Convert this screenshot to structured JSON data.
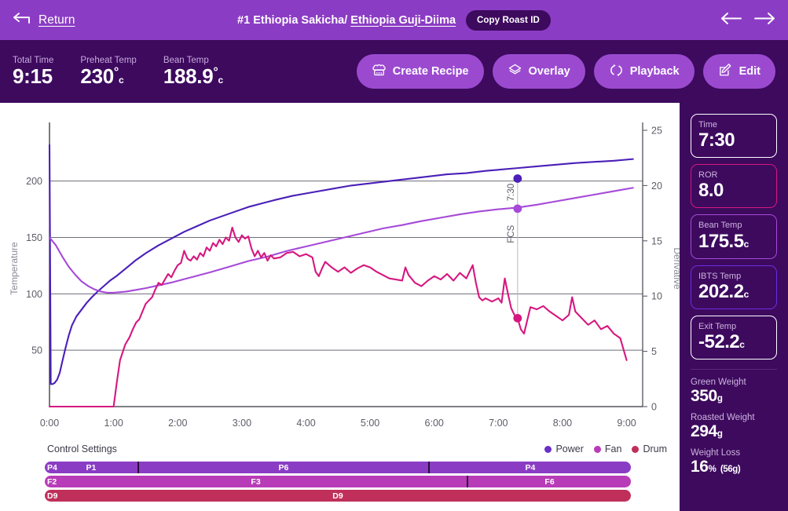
{
  "topbar": {
    "return_label": "Return",
    "return_icon": "arrow-left-icon",
    "roast_number_and_name": "#1 Ethiopia Sakicha/ ",
    "roast_linked_name": "Ethiopia Guji-Diima",
    "copy_button": "Copy Roast ID",
    "prev_icon": "arrow-left-icon",
    "next_icon": "arrow-right-icon"
  },
  "stats": [
    {
      "label": "Total Time",
      "value": "9:15",
      "degree": "",
      "unit": ""
    },
    {
      "label": "Preheat Temp",
      "value": "230",
      "degree": "°",
      "unit": "c"
    },
    {
      "label": "Bean Temp",
      "value": "188.9",
      "degree": "°",
      "unit": "c"
    }
  ],
  "actions": [
    {
      "label": "Create Recipe",
      "icon": "chef-hat-icon"
    },
    {
      "label": "Overlay",
      "icon": "layers-icon"
    },
    {
      "label": "Playback",
      "icon": "refresh-loop-icon"
    },
    {
      "label": "Edit",
      "icon": "pencil-square-icon"
    }
  ],
  "control_settings": {
    "title": "Control Settings",
    "legend": [
      {
        "label": "Power",
        "color": "#6b2fc9"
      },
      {
        "label": "Fan",
        "color": "#b83bb8"
      },
      {
        "label": "Drum",
        "color": "#bf2f5a"
      }
    ],
    "rows": [
      {
        "name": "power",
        "start_label": "P4",
        "color": "#8b3cc4",
        "segments": [
          {
            "label": "P1",
            "width_pct": 15.8
          },
          {
            "label": "P6",
            "width_pct": 49.6
          },
          {
            "label": "P4",
            "width_pct": 34.6
          }
        ]
      },
      {
        "name": "fan",
        "start_label": "F2",
        "color": "#b83bb8",
        "segments": [
          {
            "label": "F3",
            "width_pct": 72.0
          },
          {
            "label": "F6",
            "width_pct": 28.0
          }
        ]
      },
      {
        "name": "drum",
        "start_label": "D9",
        "color": "#bf2f5a",
        "segments": [
          {
            "label": "D9",
            "width_pct": 100
          }
        ]
      }
    ]
  },
  "sidebar": {
    "cards": [
      {
        "label": "Time",
        "value": "7:30",
        "unit": "",
        "border": "#ffffff"
      },
      {
        "label": "ROR",
        "value": "8.0",
        "unit": "",
        "border": "#d6177f"
      },
      {
        "label": "Bean Temp",
        "value": "175.5",
        "unit": "c",
        "border": "#a64ad8"
      },
      {
        "label": "IBTS Temp",
        "value": "202.2",
        "unit": "c",
        "border": "#6b2fe0"
      },
      {
        "label": "Exit Temp",
        "value": "-52.2",
        "unit": "c",
        "border": "#ffffff"
      }
    ],
    "weights": [
      {
        "label": "Green Weight",
        "value": "350",
        "unit": "g",
        "sub": ""
      },
      {
        "label": "Roasted Weight",
        "value": "294",
        "unit": "g",
        "sub": ""
      },
      {
        "label": "Weight Loss",
        "value": "16",
        "unit": "%",
        "sub": "(56g)"
      }
    ]
  },
  "chart_data": {
    "type": "line",
    "title": "",
    "xlabel": "",
    "ylabel": "Temperature",
    "y2label": "Derivative",
    "grid": true,
    "legend_position": "bottom-right",
    "x_ticks": [
      "0:00",
      "1:00",
      "2:00",
      "3:00",
      "4:00",
      "5:00",
      "6:00",
      "7:00",
      "8:00",
      "9:00"
    ],
    "x_tick_values": [
      0,
      1,
      2,
      3,
      4,
      5,
      6,
      7,
      8,
      9
    ],
    "xlim": [
      0,
      9.25
    ],
    "y_ticks": [
      50,
      100,
      150,
      200
    ],
    "ylim": [
      0,
      245
    ],
    "y2_ticks": [
      0,
      5,
      10,
      15,
      20,
      25
    ],
    "y2lim": [
      0,
      25
    ],
    "annotations": [
      {
        "label": "FCS",
        "x": 7.3
      },
      {
        "label": "7:30",
        "x": 7.3
      }
    ],
    "markers": [
      {
        "series": "IBTS Temp",
        "x": 7.3,
        "y": 202.2,
        "color": "#4b1fb8"
      },
      {
        "series": "Bean Temp",
        "x": 7.3,
        "y": 175.5,
        "color": "#a64ad8"
      },
      {
        "series": "ROR",
        "x": 7.3,
        "y": 8.0,
        "color": "#d6177f",
        "axis": "y2"
      }
    ],
    "series": [
      {
        "name": "IBTS Temp",
        "color": "#4b1fb8",
        "axis": "y",
        "x": [
          0,
          0.02,
          0.05,
          0.08,
          0.12,
          0.16,
          0.2,
          0.25,
          0.3,
          0.35,
          0.42,
          0.5,
          0.58,
          0.66,
          0.75,
          0.85,
          0.95,
          1.05,
          1.2,
          1.35,
          1.5,
          1.7,
          1.9,
          2.1,
          2.3,
          2.5,
          2.7,
          2.9,
          3.1,
          3.3,
          3.5,
          3.8,
          4.1,
          4.4,
          4.7,
          5.0,
          5.3,
          5.6,
          5.9,
          6.2,
          6.5,
          6.8,
          7.0,
          7.3,
          7.6,
          7.9,
          8.2,
          8.5,
          8.8,
          9.1
        ],
        "y": [
          232,
          20,
          20,
          21,
          24,
          30,
          40,
          52,
          63,
          72,
          80,
          86,
          92,
          97,
          102,
          107,
          112,
          116,
          123,
          130,
          136,
          143,
          149,
          155,
          160,
          165,
          169,
          173,
          177,
          180,
          183,
          187,
          190,
          193,
          196,
          198,
          200,
          202,
          204,
          206,
          207,
          209,
          210,
          211.5,
          213,
          214.5,
          216,
          217,
          218,
          219.5
        ]
      },
      {
        "name": "Bean Temp",
        "color": "#a64ad8",
        "axis": "y",
        "x": [
          0,
          0.1,
          0.2,
          0.3,
          0.4,
          0.5,
          0.6,
          0.7,
          0.8,
          0.9,
          1.0,
          1.1,
          1.2,
          1.35,
          1.5,
          1.7,
          1.9,
          2.1,
          2.3,
          2.5,
          2.8,
          3.1,
          3.4,
          3.7,
          4.0,
          4.3,
          4.6,
          4.9,
          5.2,
          5.5,
          5.8,
          6.1,
          6.4,
          6.7,
          7.0,
          7.3,
          7.6,
          7.9,
          8.2,
          8.5,
          8.8,
          9.1
        ],
        "y": [
          150,
          143,
          133,
          124,
          117,
          111,
          107,
          104,
          102,
          101,
          101,
          101.5,
          102,
          103.5,
          105,
          107.5,
          110,
          113,
          116,
          119,
          124,
          129,
          133,
          138,
          142,
          146,
          150,
          154,
          158,
          161,
          164.5,
          167.5,
          170.5,
          173,
          175,
          176.5,
          179,
          182,
          185,
          188,
          191,
          194
        ]
      },
      {
        "name": "ROR",
        "color": "#d6177f",
        "axis": "y2",
        "x": [
          0,
          0.5,
          1.0,
          1.05,
          1.1,
          1.18,
          1.25,
          1.3,
          1.35,
          1.4,
          1.45,
          1.5,
          1.55,
          1.6,
          1.65,
          1.7,
          1.75,
          1.8,
          1.85,
          1.9,
          1.95,
          2.0,
          2.05,
          2.1,
          2.15,
          2.2,
          2.25,
          2.3,
          2.35,
          2.4,
          2.45,
          2.5,
          2.55,
          2.6,
          2.65,
          2.7,
          2.75,
          2.8,
          2.85,
          2.9,
          2.95,
          3.0,
          3.05,
          3.1,
          3.15,
          3.2,
          3.25,
          3.3,
          3.35,
          3.4,
          3.45,
          3.5,
          3.6,
          3.7,
          3.8,
          3.9,
          4.0,
          4.1,
          4.15,
          4.2,
          4.25,
          4.3,
          4.4,
          4.5,
          4.6,
          4.7,
          4.8,
          4.9,
          5.0,
          5.1,
          5.2,
          5.3,
          5.4,
          5.5,
          5.55,
          5.6,
          5.7,
          5.8,
          5.9,
          6.0,
          6.1,
          6.2,
          6.3,
          6.4,
          6.5,
          6.6,
          6.65,
          6.7,
          6.75,
          6.8,
          6.9,
          7.0,
          7.05,
          7.1,
          7.15,
          7.2,
          7.25,
          7.3,
          7.35,
          7.4,
          7.5,
          7.6,
          7.7,
          7.8,
          7.9,
          8.0,
          8.1,
          8.15,
          8.2,
          8.3,
          8.4,
          8.5,
          8.6,
          8.7,
          8.8,
          8.9,
          9.0,
          9.05,
          9.1
        ],
        "y": [
          0,
          0,
          0,
          2.2,
          4.2,
          5.6,
          6.3,
          7.0,
          7.6,
          7.9,
          8.6,
          9.3,
          9.6,
          9.9,
          10.6,
          11.2,
          11.0,
          11.5,
          12.0,
          11.7,
          12.3,
          12.8,
          13.0,
          14.1,
          13.4,
          13.2,
          13.6,
          13.3,
          13.9,
          13.6,
          14.4,
          14.1,
          14.8,
          14.5,
          15.1,
          14.7,
          15.3,
          15.0,
          16.2,
          15.3,
          14.9,
          15.5,
          15.2,
          15.4,
          14.3,
          13.6,
          14.1,
          13.5,
          13.9,
          13.2,
          13.7,
          13.4,
          13.5,
          13.9,
          14.0,
          13.6,
          13.8,
          13.5,
          12.2,
          11.8,
          12.5,
          13.1,
          12.6,
          12.2,
          12.6,
          12.1,
          12.5,
          12.8,
          12.6,
          12.2,
          11.9,
          11.6,
          11.5,
          11.4,
          12.6,
          11.9,
          11.2,
          10.9,
          11.4,
          11.8,
          11.5,
          12.0,
          11.4,
          12.1,
          11.6,
          12.8,
          11.2,
          9.9,
          9.6,
          9.8,
          9.5,
          9.8,
          9.4,
          11.6,
          10.2,
          8.9,
          8.3,
          8.0,
          7.0,
          6.6,
          9.0,
          8.8,
          9.1,
          8.6,
          8.2,
          7.8,
          8.3,
          9.9,
          8.6,
          8.0,
          7.4,
          7.8,
          7.0,
          7.3,
          6.6,
          6.2,
          4.2
        ]
      }
    ]
  }
}
